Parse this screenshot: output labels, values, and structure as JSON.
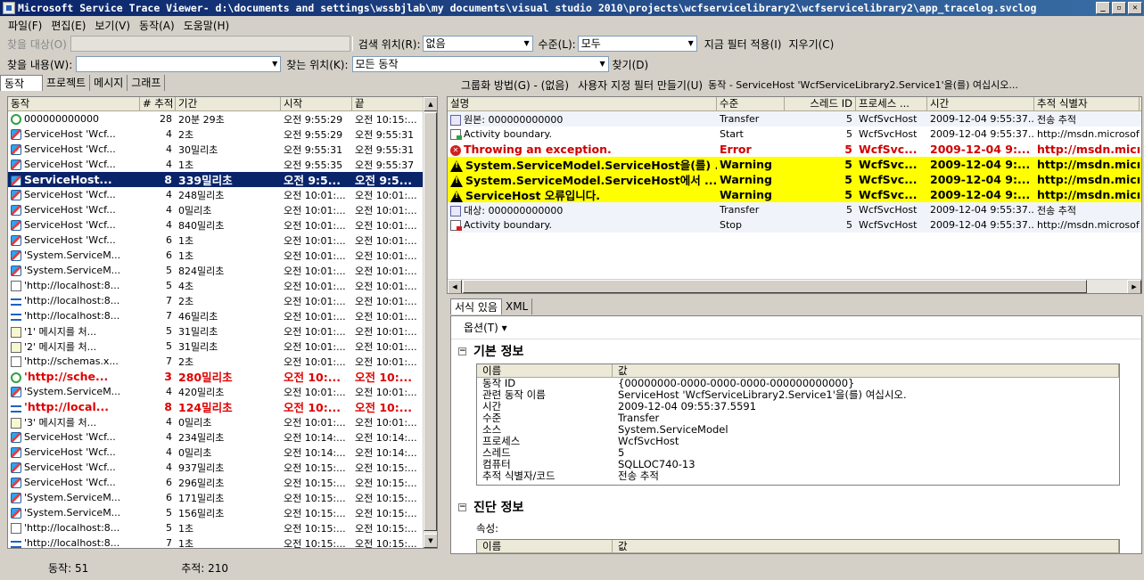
{
  "window": {
    "title": "Microsoft Service Trace Viewer- d:\\documents and settings\\wssbjlab\\my documents\\visual studio 2010\\projects\\wcfservicelibrary2\\wcfservicelibrary2\\app_tracelog.svclog"
  },
  "menu": [
    "파일(F)",
    "편집(E)",
    "보기(V)",
    "동작(A)",
    "도움말(H)"
  ],
  "toolbar1": {
    "find_target_label": "찾을 대상(O)",
    "search_location_label": "검색 위치(R):",
    "search_location_value": "없음",
    "level_label": "수준(L):",
    "level_value": "모두",
    "apply_filter": "지금 필터 적용(I)",
    "clear": "지우기(C)"
  },
  "toolbar2": {
    "find_what_label": "찾을 내용(W):",
    "look_in_label": "찾는 위치(K):",
    "look_in_value": "모든 동작",
    "find_button": "찾기(D)"
  },
  "left_tabs": [
    "동작",
    "프로젝트",
    "메시지",
    "그래프"
  ],
  "right_toolbar": {
    "group_by": "그룹화 방법(G) - (없음)",
    "custom_filter": "사용자 지정 필터 만들기(U)",
    "activity_title": "동작 - ServiceHost 'WcfServiceLibrary2.Service1'을(를) 여십시오..."
  },
  "activity_list": {
    "columns": [
      "동작",
      "# 추적",
      "기간",
      "시작",
      "끝"
    ],
    "rows": [
      {
        "icon": "cycle",
        "name": "000000000000",
        "traces": "28",
        "duration": "20분 29초",
        "start": "오전 9:55:29",
        "end": "오전 10:15:...",
        "style": ""
      },
      {
        "icon": "activity",
        "name": "ServiceHost 'Wcf...",
        "traces": "4",
        "duration": "2초",
        "start": "오전 9:55:29",
        "end": "오전 9:55:31",
        "style": ""
      },
      {
        "icon": "activity",
        "name": "ServiceHost 'Wcf...",
        "traces": "4",
        "duration": "30밀리초",
        "start": "오전 9:55:31",
        "end": "오전 9:55:31",
        "style": ""
      },
      {
        "icon": "activity",
        "name": "ServiceHost 'Wcf...",
        "traces": "4",
        "duration": "1초",
        "start": "오전 9:55:35",
        "end": "오전 9:55:37",
        "style": ""
      },
      {
        "icon": "activity",
        "name": "ServiceHost...",
        "traces": "8",
        "duration": "339밀리초",
        "start": "오전 9:5...",
        "end": "오전 9:5...",
        "style": "sel"
      },
      {
        "icon": "activity",
        "name": "ServiceHost 'Wcf...",
        "traces": "4",
        "duration": "248밀리초",
        "start": "오전 10:01:...",
        "end": "오전 10:01:...",
        "style": ""
      },
      {
        "icon": "activity",
        "name": "ServiceHost 'Wcf...",
        "traces": "4",
        "duration": "0밀리초",
        "start": "오전 10:01:...",
        "end": "오전 10:01:...",
        "style": ""
      },
      {
        "icon": "activity",
        "name": "ServiceHost 'Wcf...",
        "traces": "4",
        "duration": "840밀리초",
        "start": "오전 10:01:...",
        "end": "오전 10:01:...",
        "style": ""
      },
      {
        "icon": "activity",
        "name": "ServiceHost 'Wcf...",
        "traces": "6",
        "duration": "1초",
        "start": "오전 10:01:...",
        "end": "오전 10:01:...",
        "style": ""
      },
      {
        "icon": "activity",
        "name": "'System.ServiceM...",
        "traces": "6",
        "duration": "1초",
        "start": "오전 10:01:...",
        "end": "오전 10:01:...",
        "style": ""
      },
      {
        "icon": "activity",
        "name": "'System.ServiceM...",
        "traces": "5",
        "duration": "824밀리초",
        "start": "오전 10:01:...",
        "end": "오전 10:01:...",
        "style": ""
      },
      {
        "icon": "doc",
        "name": "'http://localhost:8...",
        "traces": "5",
        "duration": "4초",
        "start": "오전 10:01:...",
        "end": "오전 10:01:...",
        "style": ""
      },
      {
        "icon": "arrows",
        "name": "'http://localhost:8...",
        "traces": "7",
        "duration": "2초",
        "start": "오전 10:01:...",
        "end": "오전 10:01:...",
        "style": ""
      },
      {
        "icon": "arrows",
        "name": "'http://localhost:8...",
        "traces": "7",
        "duration": "46밀리초",
        "start": "오전 10:01:...",
        "end": "오전 10:01:...",
        "style": ""
      },
      {
        "icon": "doc2",
        "name": "'1' 메시지를 처...",
        "traces": "5",
        "duration": "31밀리초",
        "start": "오전 10:01:...",
        "end": "오전 10:01:...",
        "style": ""
      },
      {
        "icon": "doc2",
        "name": "'2' 메시지를 처...",
        "traces": "5",
        "duration": "31밀리초",
        "start": "오전 10:01:...",
        "end": "오전 10:01:...",
        "style": ""
      },
      {
        "icon": "doc",
        "name": "'http://schemas.x...",
        "traces": "7",
        "duration": "2초",
        "start": "오전 10:01:...",
        "end": "오전 10:01:...",
        "style": ""
      },
      {
        "icon": "cycle",
        "name": "'http://sche...",
        "traces": "3",
        "duration": "280밀리초",
        "start": "오전 10:...",
        "end": "오전 10:...",
        "style": "err"
      },
      {
        "icon": "activity",
        "name": "'System.ServiceM...",
        "traces": "4",
        "duration": "420밀리초",
        "start": "오전 10:01:...",
        "end": "오전 10:01:...",
        "style": ""
      },
      {
        "icon": "arrows",
        "name": "'http://local...",
        "traces": "8",
        "duration": "124밀리초",
        "start": "오전 10:...",
        "end": "오전 10:...",
        "style": "err"
      },
      {
        "icon": "doc2",
        "name": "'3' 메시지를 처...",
        "traces": "4",
        "duration": "0밀리초",
        "start": "오전 10:01:...",
        "end": "오전 10:01:...",
        "style": ""
      },
      {
        "icon": "activity",
        "name": "ServiceHost 'Wcf...",
        "traces": "4",
        "duration": "234밀리초",
        "start": "오전 10:14:...",
        "end": "오전 10:14:...",
        "style": ""
      },
      {
        "icon": "activity",
        "name": "ServiceHost 'Wcf...",
        "traces": "4",
        "duration": "0밀리초",
        "start": "오전 10:14:...",
        "end": "오전 10:14:...",
        "style": ""
      },
      {
        "icon": "activity",
        "name": "ServiceHost 'Wcf...",
        "traces": "4",
        "duration": "937밀리초",
        "start": "오전 10:15:...",
        "end": "오전 10:15:...",
        "style": ""
      },
      {
        "icon": "activity",
        "name": "ServiceHost 'Wcf...",
        "traces": "6",
        "duration": "296밀리초",
        "start": "오전 10:15:...",
        "end": "오전 10:15:...",
        "style": ""
      },
      {
        "icon": "activity",
        "name": "'System.ServiceM...",
        "traces": "6",
        "duration": "171밀리초",
        "start": "오전 10:15:...",
        "end": "오전 10:15:...",
        "style": ""
      },
      {
        "icon": "activity",
        "name": "'System.ServiceM...",
        "traces": "5",
        "duration": "156밀리초",
        "start": "오전 10:15:...",
        "end": "오전 10:15:...",
        "style": ""
      },
      {
        "icon": "doc",
        "name": "'http://localhost:8...",
        "traces": "5",
        "duration": "1초",
        "start": "오전 10:15:...",
        "end": "오전 10:15:...",
        "style": ""
      },
      {
        "icon": "arrows",
        "name": "'http://localhost:8...",
        "traces": "7",
        "duration": "1초",
        "start": "오전 10:15:...",
        "end": "오전 10:15:...",
        "style": ""
      }
    ]
  },
  "trace_list": {
    "columns": [
      "설명",
      "수준",
      "스레드 ID",
      "프로세스 ...",
      "시간",
      "추적 식별자"
    ],
    "rows": [
      {
        "icon": "transfer",
        "desc": "원본: 000000000000",
        "level": "Transfer",
        "thread": "5",
        "process": "WcfSvcHost",
        "time": "2009-12-04 9:55:37....",
        "trace_id": "전송 추적",
        "style": "alt"
      },
      {
        "icon": "start",
        "desc": "Activity boundary.",
        "level": "Start",
        "thread": "5",
        "process": "WcfSvcHost",
        "time": "2009-12-04 9:55:37....",
        "trace_id": "http://msdn.microsoft.c",
        "style": ""
      },
      {
        "icon": "err",
        "desc": "Throwing an exception.",
        "level": "Error",
        "thread": "5",
        "process": "WcfSvc...",
        "time": "2009-12-04 9:...",
        "trace_id": "http://msdn.micr",
        "style": "errtr"
      },
      {
        "icon": "warn",
        "desc": "System.ServiceModel.ServiceHost을(를) ...",
        "level": "Warning",
        "thread": "5",
        "process": "WcfSvc...",
        "time": "2009-12-04 9:...",
        "trace_id": "http://msdn.micr",
        "style": "hilite"
      },
      {
        "icon": "warn",
        "desc": "System.ServiceModel.ServiceHost에서 ...",
        "level": "Warning",
        "thread": "5",
        "process": "WcfSvc...",
        "time": "2009-12-04 9:...",
        "trace_id": "http://msdn.micr",
        "style": "hilite"
      },
      {
        "icon": "warn",
        "desc": "ServiceHost 오류입니다.",
        "level": "Warning",
        "thread": "5",
        "process": "WcfSvc...",
        "time": "2009-12-04 9:...",
        "trace_id": "http://msdn.micr",
        "style": "hilite"
      },
      {
        "icon": "transfer",
        "desc": "대상: 000000000000",
        "level": "Transfer",
        "thread": "5",
        "process": "WcfSvcHost",
        "time": "2009-12-04 9:55:37....",
        "trace_id": "전송 추적",
        "style": "alt"
      },
      {
        "icon": "stop",
        "desc": "Activity boundary.",
        "level": "Stop",
        "thread": "5",
        "process": "WcfSvcHost",
        "time": "2009-12-04 9:55:37....",
        "trace_id": "http://msdn.microsoft.com",
        "style": "alt"
      }
    ]
  },
  "detail_tabs": [
    "서식 있음",
    "XML"
  ],
  "detail": {
    "options_label": "옵션(T)",
    "basic_info_title": "기본 정보",
    "kv_headers": [
      "이름",
      "값"
    ],
    "kv_rows": [
      [
        "동작 ID",
        "{00000000-0000-0000-0000-000000000000}"
      ],
      [
        "관련 동작 이름",
        "ServiceHost 'WcfServiceLibrary2.Service1'을(를) 여십시오."
      ],
      [
        "시간",
        "2009-12-04 09:55:37.5591"
      ],
      [
        "수준",
        "Transfer"
      ],
      [
        "소스",
        "System.ServiceModel"
      ],
      [
        "프로세스",
        "WcfSvcHost"
      ],
      [
        "스레드",
        "5"
      ],
      [
        "컴퓨터",
        "SQLLOC740-13"
      ],
      [
        "추적 식별자/코드",
        "전송 추적"
      ]
    ],
    "diag_title": "진단 정보",
    "properties_label": "속성:",
    "kv2_headers": [
      "이름",
      "값"
    ]
  },
  "status": {
    "activities": "동작: 51",
    "traces": "추적: 210"
  }
}
